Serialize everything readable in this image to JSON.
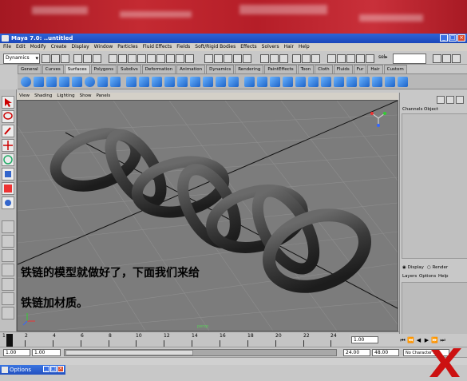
{
  "window": {
    "title": "Maya 7.0: ..untitled",
    "controls": [
      "_",
      "□",
      "×"
    ]
  },
  "menubar": {
    "items": [
      "File",
      "Edit",
      "Modify",
      "Create",
      "Display",
      "Window",
      "Particles",
      "Fluid Effects",
      "Fields",
      "Soft/Rigid Bodies",
      "Effects",
      "Solvers",
      "Hair",
      "Help"
    ]
  },
  "statusline": {
    "menu_set": "Dynamics",
    "selection_label": "sel▸"
  },
  "shelf": {
    "tabs": [
      "General",
      "Curves",
      "Surfaces",
      "Polygons",
      "Subdivs",
      "Deformation",
      "Animation",
      "Dynamics",
      "Rendering",
      "PaintEffects",
      "Toon",
      "Cloth",
      "Fluids",
      "Fur",
      "Hair",
      "Custom"
    ],
    "active_tab": "Surfaces"
  },
  "viewport": {
    "menu": [
      "View",
      "Shading",
      "Lighting",
      "Show",
      "Panels"
    ],
    "camera_label": "persp",
    "subtitle_line1": "铁链的模型就做好了，下面我们来给",
    "subtitle_line2": "铁链加材质。"
  },
  "channelbox": {
    "tabs": [
      "Channels",
      "Object"
    ],
    "display_radio": "Display",
    "render_radio": "Render",
    "layers_menu": [
      "Layers",
      "Options",
      "Help"
    ]
  },
  "timeslider": {
    "ticks": [
      "1",
      "2",
      "4",
      "6",
      "8",
      "10",
      "12",
      "14",
      "16",
      "18",
      "20",
      "22",
      "24"
    ],
    "current_frame": "1.00"
  },
  "rangeslider": {
    "start": "1.00",
    "start_inner": "1.00",
    "end_inner": "24.00",
    "end": "48.00",
    "character_set": "No Character Set"
  },
  "taskbar": {
    "options_title": "Options"
  },
  "colors": {
    "banner": "#b52028",
    "titlebar": "#1c47b8",
    "viewport_bg": "#7c7c7c",
    "accent_logo": "#cc1111"
  }
}
